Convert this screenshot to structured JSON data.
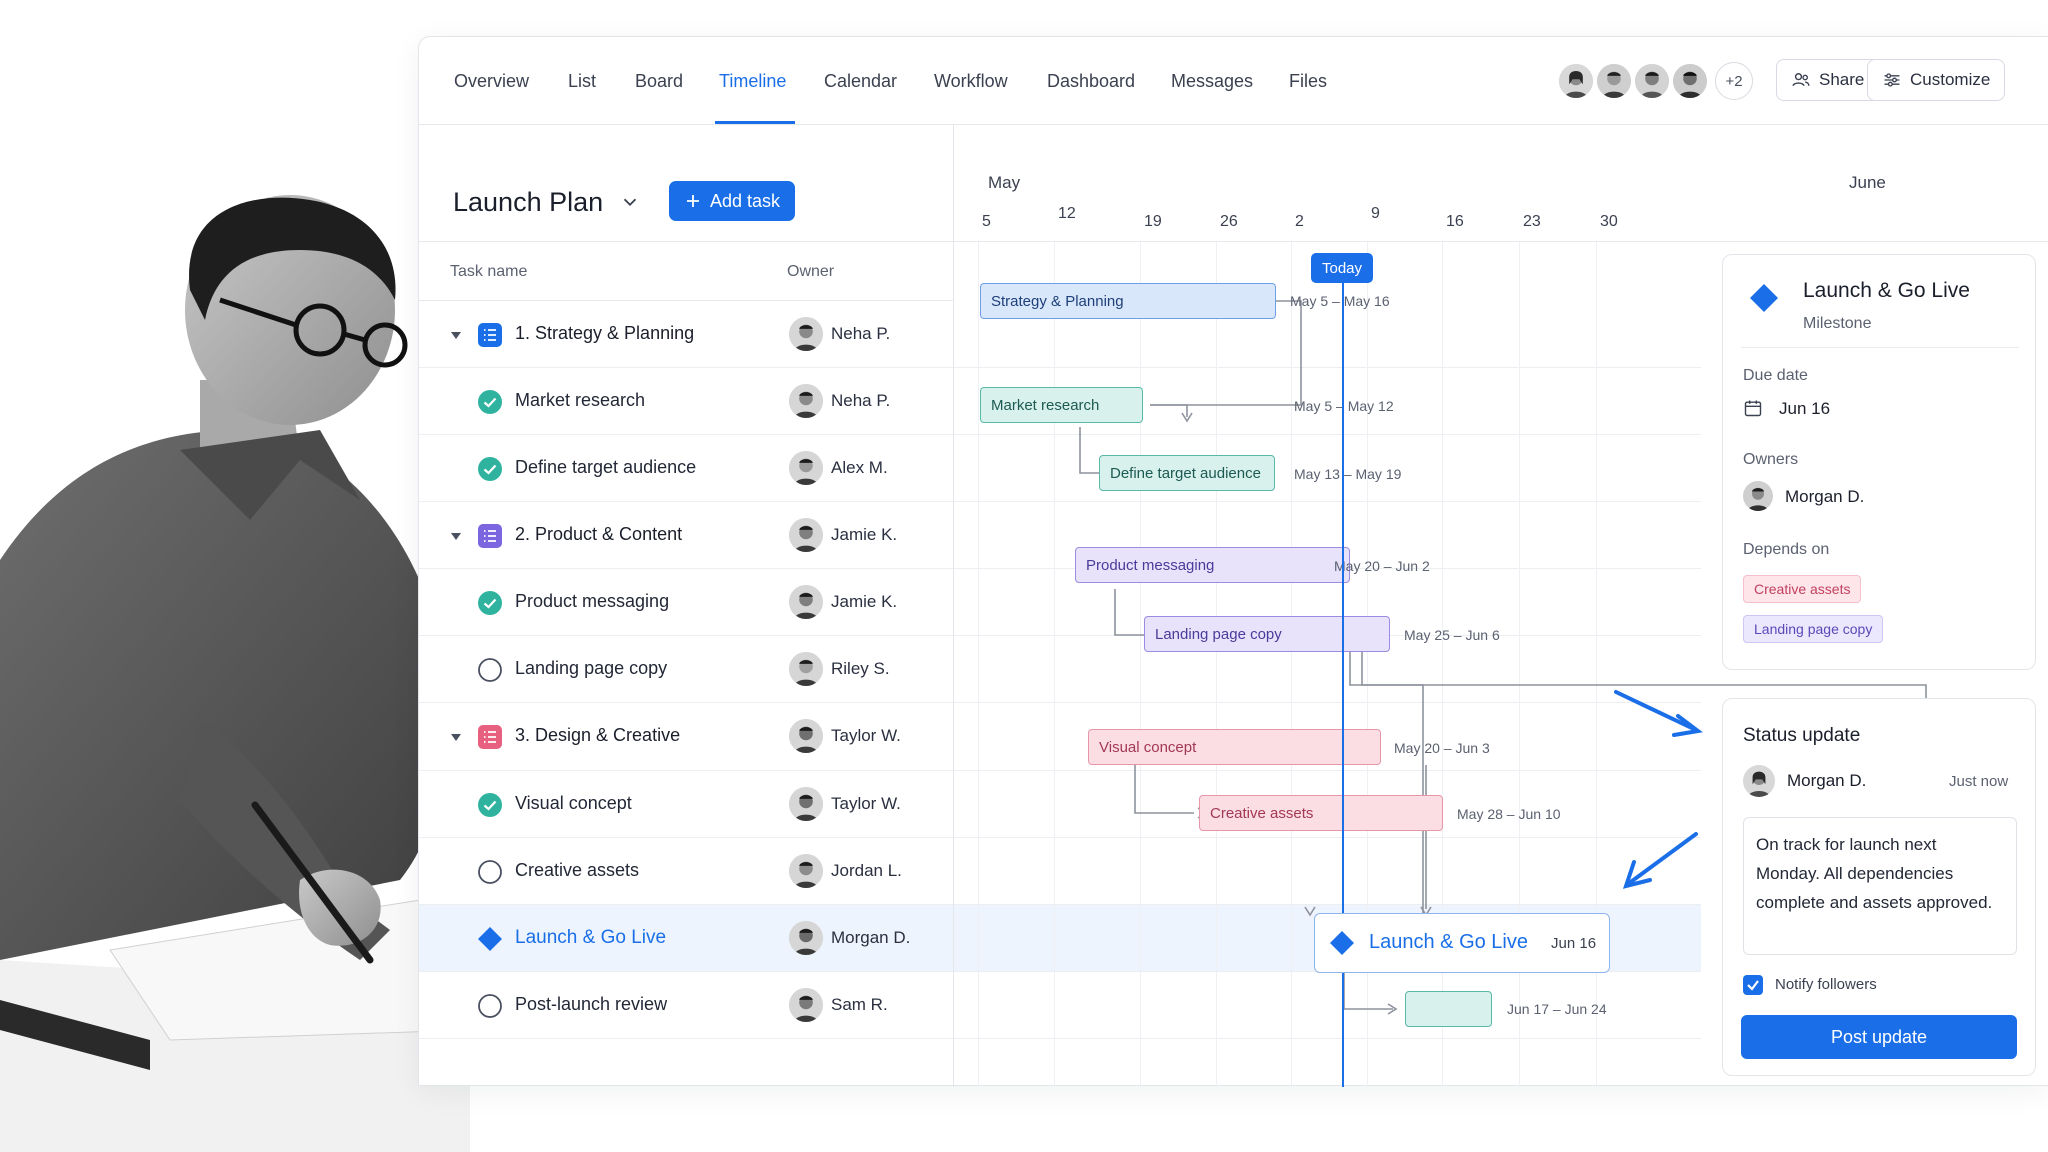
{
  "nav": {
    "tabs": [
      {
        "label": "Overview"
      },
      {
        "label": "List"
      },
      {
        "label": "Board"
      },
      {
        "label": "Timeline",
        "active": true
      },
      {
        "label": "Calendar"
      },
      {
        "label": "Workflow"
      },
      {
        "label": "Dashboard"
      },
      {
        "label": "Messages"
      },
      {
        "label": "Files"
      }
    ],
    "more_members": "+2",
    "share_label": "Share",
    "customize_label": "Customize"
  },
  "plan": {
    "title": "Launch Plan",
    "add_task_label": "Add task"
  },
  "columns": {
    "task": "Task name",
    "owner": "Owner"
  },
  "tasks": [
    {
      "name": "1. Strategy & Planning",
      "owner": "Neha P."
    },
    {
      "name": "Market research",
      "owner": "Neha P."
    },
    {
      "name": "Define target audience",
      "owner": "Alex M."
    },
    {
      "name": "2. Product & Content",
      "owner": "Jamie K."
    },
    {
      "name": "Product messaging",
      "owner": "Jamie K."
    },
    {
      "name": "Landing page copy",
      "owner": "Riley S."
    },
    {
      "name": "3. Design & Creative",
      "owner": "Taylor W."
    },
    {
      "name": "Visual concept",
      "owner": "Taylor W."
    },
    {
      "name": "Creative assets",
      "owner": "Jordan L."
    },
    {
      "name": "Launch & Go Live",
      "owner": "Morgan D."
    },
    {
      "name": "Post-launch review",
      "owner": "Sam R."
    }
  ],
  "timeline": {
    "months": [
      "May",
      "June"
    ],
    "weeks": [
      "5",
      "12",
      "19",
      "26",
      "2",
      "9",
      "16",
      "23",
      "30"
    ],
    "today_label": "Today",
    "bars": [
      {
        "label": "Strategy & Planning",
        "range": "May 5 – May 16"
      },
      {
        "label": "Market research",
        "range": "May 5 – May 12"
      },
      {
        "label": "Define target audience",
        "range": "May 13 – May 19"
      },
      {
        "label": "Product messaging",
        "range": "May 20 – Jun 2"
      },
      {
        "label": "Landing page copy",
        "range": "May 25 – Jun 6"
      },
      {
        "label": "Visual concept",
        "range": "May 20 – Jun 3"
      },
      {
        "label": "Creative assets",
        "range": "May 28 – Jun 10"
      },
      {
        "label": "",
        "range": "Jun 17 – Jun 24"
      }
    ],
    "milestone": {
      "label": "Launch & Go Live",
      "date": "Jun 16"
    }
  },
  "detail": {
    "title": "Launch & Go Live",
    "subtitle": "Milestone",
    "due_label": "Due date",
    "due_value": "Jun 16",
    "owners_label": "Owners",
    "owner": "Morgan D.",
    "depends_label": "Depends on",
    "depends": [
      "Creative assets",
      "Landing page copy"
    ]
  },
  "status": {
    "title": "Status update",
    "author": "Morgan D.",
    "time": "Just now",
    "message": "On track for launch next Monday. All dependencies complete and assets approved.",
    "notify_label": "Notify followers",
    "post_label": "Post update"
  },
  "colors": {
    "accent": "#1a6fe8",
    "teal": "#2fb39f",
    "purple": "#7b66e0",
    "pink": "#e8607f"
  }
}
